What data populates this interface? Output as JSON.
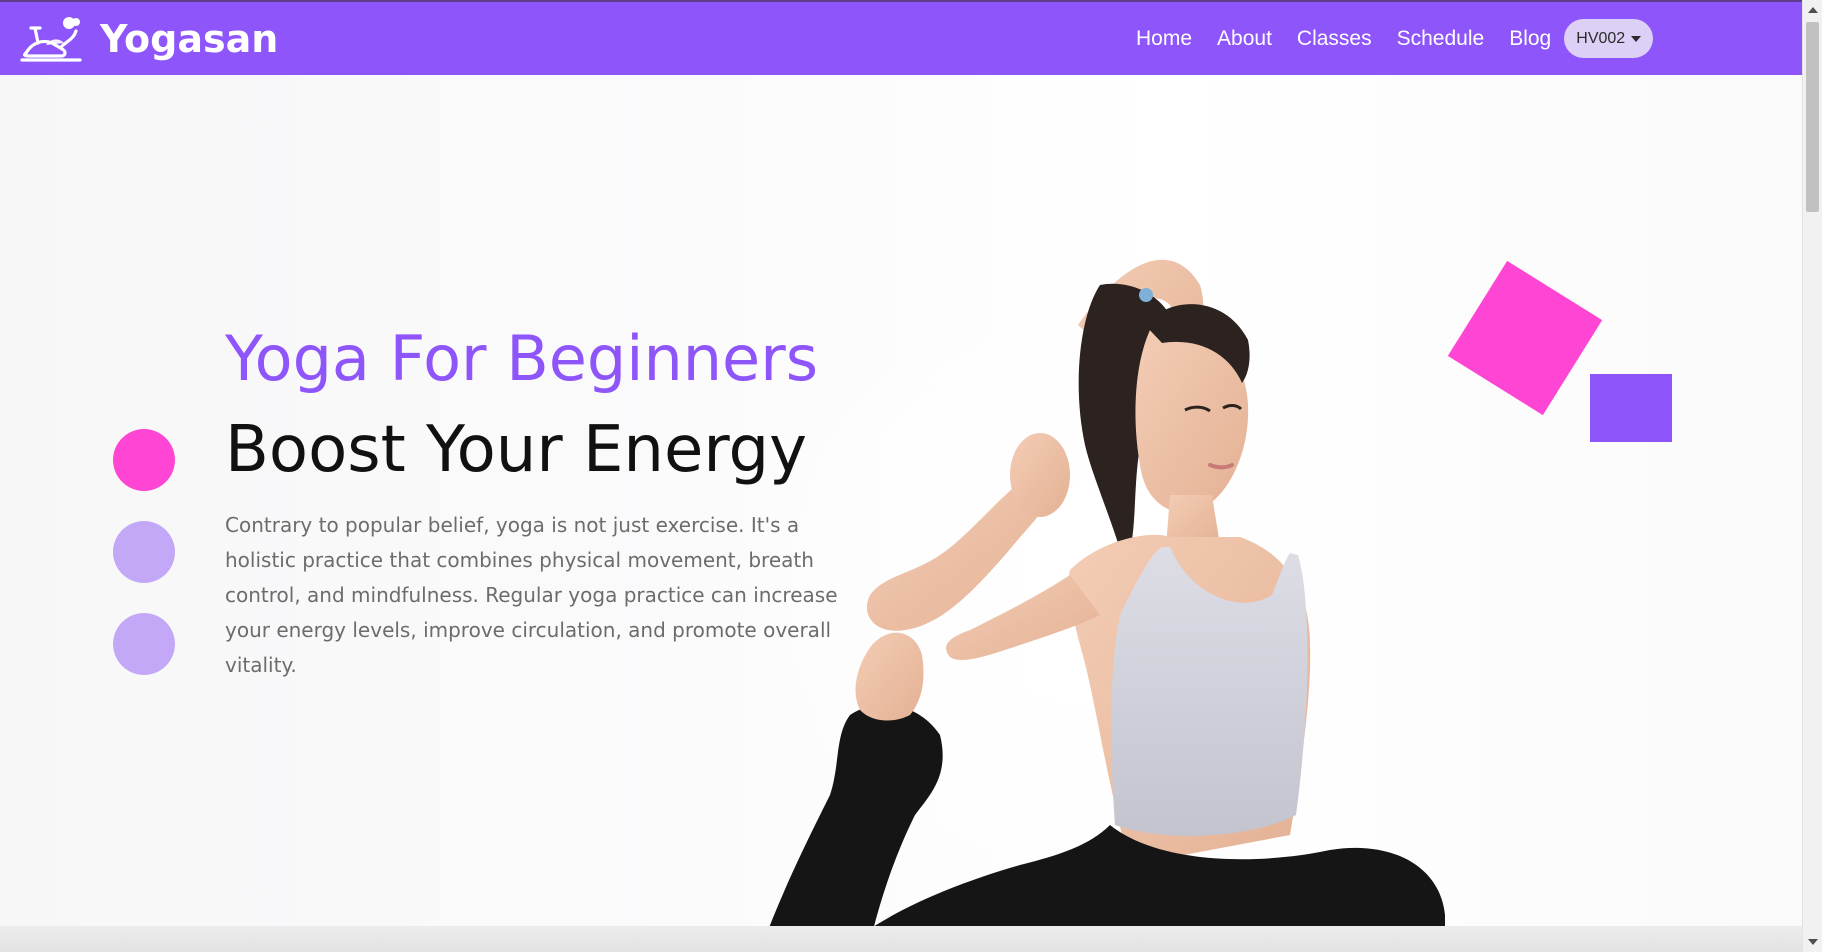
{
  "colors": {
    "nav_bg": "#8e55fa",
    "accent_purple": "#8e55fa",
    "accent_pink": "#ff45d4",
    "dot_inactive": "#c3a8f7"
  },
  "brand": {
    "name": "Yogasan",
    "logo_icon": "yoga-mat-logo-icon"
  },
  "nav": {
    "items": [
      {
        "label": "Home"
      },
      {
        "label": "About"
      },
      {
        "label": "Classes"
      },
      {
        "label": "Schedule"
      },
      {
        "label": "Blog"
      }
    ],
    "language_select": {
      "value": "HV002",
      "icon": "caret-down-icon"
    }
  },
  "hero": {
    "kicker": "Yoga For Beginners",
    "headline": "Boost Your Energy",
    "description": "Contrary to popular belief, yoga is not just exercise. It's a holistic practice that combines physical movement, breath control, and mindfulness. Regular yoga practice can increase your energy levels, improve circulation, and promote overall vitality.",
    "slides": {
      "count": 3,
      "active_index": 0
    }
  }
}
